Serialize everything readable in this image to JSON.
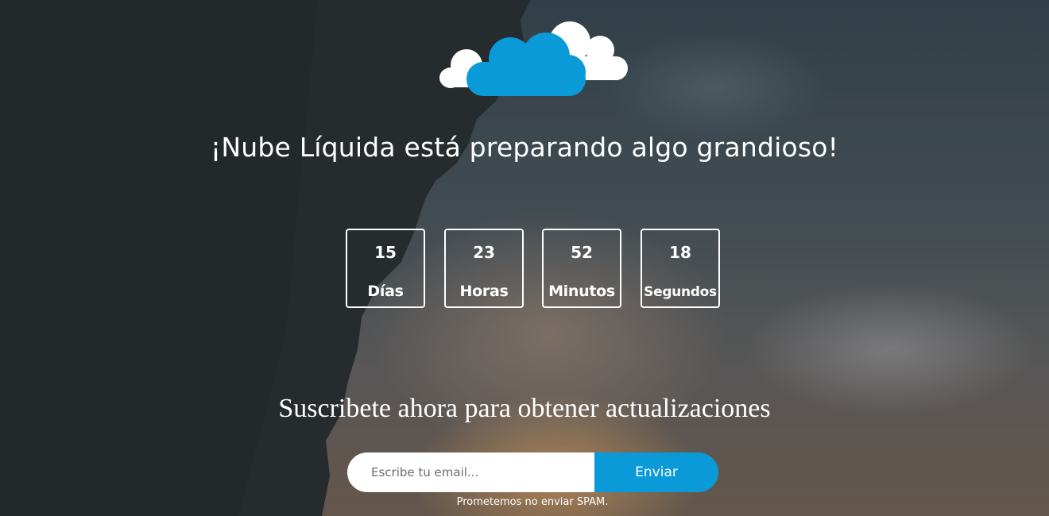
{
  "brand": {
    "cloud_color": "#0a9ad8",
    "cloud_back_color": "#ffffff"
  },
  "headline": "¡Nube Líquida está preparando algo grandioso!",
  "countdown": [
    {
      "value": "15",
      "label": "Días"
    },
    {
      "value": "23",
      "label": "Horas"
    },
    {
      "value": "52",
      "label": "Minutos"
    },
    {
      "value": "18",
      "label": "Segundos"
    }
  ],
  "subscribe": {
    "title": "Suscribete ahora para obtener actualizaciones",
    "email_placeholder": "Escribe tu email...",
    "email_value": "",
    "submit_label": "Enviar",
    "note": "Prometemos no enviar SPAM."
  }
}
